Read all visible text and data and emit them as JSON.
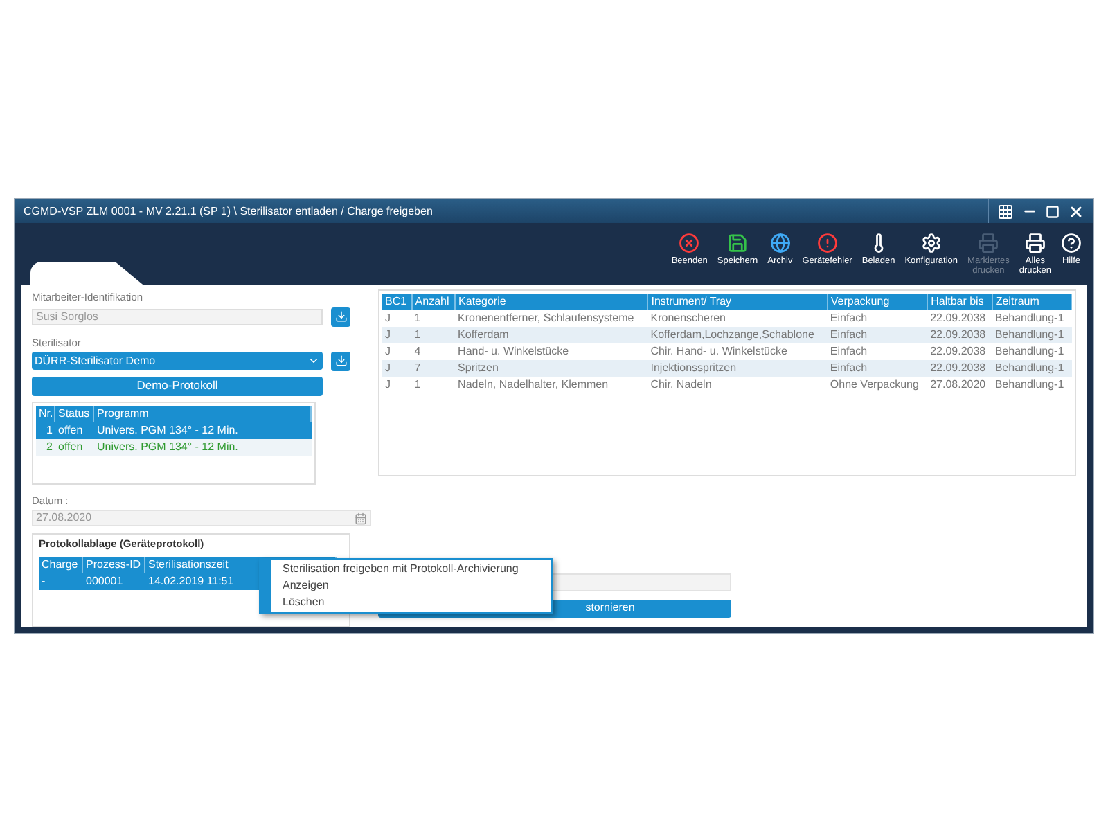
{
  "window": {
    "title": "CGMD-VSP ZLM 0001 - MV 2.21.1 (SP 1) \\ Sterilisator entladen / Charge freigeben"
  },
  "toolbar": [
    {
      "kind": "quit",
      "label": "Beenden",
      "disabled": false
    },
    {
      "kind": "save",
      "label": "Speichern",
      "disabled": false
    },
    {
      "kind": "archive",
      "label": "Archiv",
      "disabled": false
    },
    {
      "kind": "fault",
      "label": "Gerätefehler",
      "disabled": false
    },
    {
      "kind": "load",
      "label": "Beladen",
      "disabled": false
    },
    {
      "kind": "config",
      "label": "Konfiguration",
      "disabled": false
    },
    {
      "kind": "print",
      "label": "Markiertes drucken",
      "disabled": true
    },
    {
      "kind": "print",
      "label": "Alles drucken",
      "disabled": false
    },
    {
      "kind": "help",
      "label": "Hilfe",
      "disabled": false
    }
  ],
  "employee": {
    "label": "Mitarbeiter-Identifikation",
    "value": "Susi Sorglos"
  },
  "sterilizer": {
    "label": "Sterilisator",
    "value": "DÜRR-Sterilisator Demo"
  },
  "demo_button": "Demo-Protokoll",
  "programs": {
    "columns": [
      "Nr.",
      "Status",
      "Programm"
    ],
    "rows": [
      {
        "cells": [
          "1",
          "offen",
          "Univers. PGM 134° - 12 Min."
        ],
        "selected": true
      },
      {
        "cells": [
          "2",
          "offen",
          "Univers. PGM 134° - 12 Min."
        ],
        "selected": false
      }
    ]
  },
  "date": {
    "label": "Datum :",
    "value": "27.08.2020"
  },
  "protocol_archive": {
    "title": "Protokollablage (Geräteprotokoll)",
    "columns": [
      "Charge",
      "Prozess-ID",
      "Sterilisationszeit"
    ],
    "rows": [
      {
        "cells": [
          "-",
          "000001",
          "14.02.2019 11:51"
        ],
        "selected": true
      }
    ]
  },
  "items_table": {
    "columns": [
      "BC1",
      "Anzahl",
      "Kategorie",
      "Instrument/ Tray",
      "Verpackung",
      "Haltbar bis",
      "Zeitraum"
    ],
    "rows": [
      {
        "cells": [
          "J",
          "1",
          "Kronenentferner, Schlaufensysteme",
          "Kronenscheren",
          "Einfach",
          "22.09.2038",
          "Behandlung-1"
        ]
      },
      {
        "cells": [
          "J",
          "1",
          "Kofferdam",
          "Kofferdam,Lochzange,Schablone",
          "Einfach",
          "22.09.2038",
          "Behandlung-1"
        ]
      },
      {
        "cells": [
          "J",
          "4",
          "Hand- u. Winkelstücke",
          "Chir. Hand- u. Winkelstücke",
          "Einfach",
          "22.09.2038",
          "Behandlung-1"
        ]
      },
      {
        "cells": [
          "J",
          "7",
          "Spritzen",
          "Injektionsspritzen",
          "Einfach",
          "22.09.2038",
          "Behandlung-1"
        ]
      },
      {
        "cells": [
          "J",
          "1",
          "Nadeln, Nadelhalter, Klemmen",
          "Chir. Nadeln",
          "Ohne Verpackung",
          "27.08.2020",
          "Behandlung-1"
        ]
      }
    ]
  },
  "bottom_button": "stornieren",
  "context_menu": [
    {
      "label": "Sterilisation freigeben mit Protokoll-Archivierung"
    },
    {
      "label": "Anzeigen"
    },
    {
      "label": "Löschen"
    }
  ]
}
